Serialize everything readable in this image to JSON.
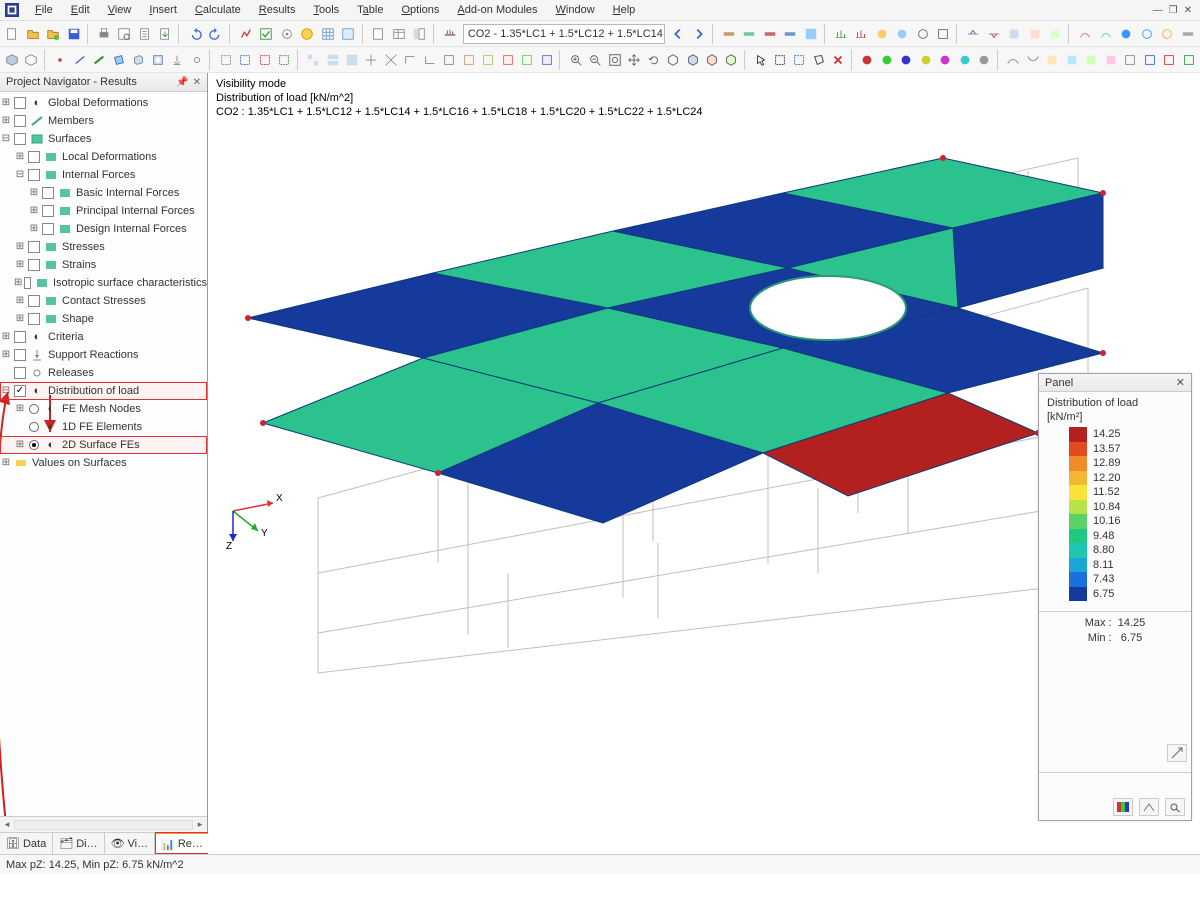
{
  "menu": {
    "items": [
      "File",
      "Edit",
      "View",
      "Insert",
      "Calculate",
      "Results",
      "Tools",
      "Table",
      "Options",
      "Add-on Modules",
      "Window",
      "Help"
    ]
  },
  "toolbar1": {
    "load_case": "CO2 - 1.35*LC1 + 1.5*LC12 + 1.5*LC14"
  },
  "sidebar": {
    "title": "Project Navigator - Results",
    "items": {
      "global_deformations": "Global Deformations",
      "members": "Members",
      "surfaces": "Surfaces",
      "local_deformations": "Local Deformations",
      "internal_forces": "Internal Forces",
      "basic_internal_forces": "Basic Internal Forces",
      "principal_internal_forces": "Principal Internal Forces",
      "design_internal_forces": "Design Internal Forces",
      "stresses": "Stresses",
      "strains": "Strains",
      "isotropic_surface": "Isotropic surface characteristics",
      "contact_stresses": "Contact Stresses",
      "shape": "Shape",
      "criteria": "Criteria",
      "support_reactions": "Support Reactions",
      "releases": "Releases",
      "distribution_of_load": "Distribution of load",
      "fe_mesh_nodes": "FE Mesh Nodes",
      "one_d_fe_elements": "1D FE Elements",
      "two_d_surface_fes": "2D Surface FEs",
      "values_on_surfaces": "Values on Surfaces"
    },
    "tabs": {
      "data": "Data",
      "display": "Di…",
      "views": "Vi…",
      "results": "Re…"
    }
  },
  "viewport": {
    "line1": "Visibility mode",
    "line2": "Distribution of load [kN/m^2]",
    "line3": "CO2 : 1.35*LC1 + 1.5*LC12 + 1.5*LC14 + 1.5*LC16 + 1.5*LC18 + 1.5*LC20 + 1.5*LC22 + 1.5*LC24",
    "axes": {
      "x": "X",
      "y": "Y",
      "z": "Z"
    }
  },
  "panel": {
    "title": "Panel",
    "heading": "Distribution of load",
    "unit": "[kN/m²]",
    "ticks": [
      "14.25",
      "13.57",
      "12.89",
      "12.20",
      "11.52",
      "10.84",
      "10.16",
      "9.48",
      "8.80",
      "8.11",
      "7.43",
      "6.75"
    ],
    "colors": [
      "#b32020",
      "#e24a1f",
      "#f08a2a",
      "#f4b733",
      "#f8e23b",
      "#b7e24b",
      "#5ad169",
      "#23c784",
      "#20c7b0",
      "#1aa7d6",
      "#1d6fe0",
      "#153a9c"
    ],
    "max_label": "Max :",
    "max_value": "14.25",
    "min_label": "Min :",
    "min_value": "6.75"
  },
  "status": {
    "text": "Max pZ: 14.25, Min pZ: 6.75 kN/m^2"
  },
  "chart_data": {
    "type": "heatmap",
    "title": "Distribution of load",
    "unit": "kN/m^2",
    "legend_range": [
      6.75,
      14.25
    ],
    "legend_ticks": [
      14.25,
      13.57,
      12.89,
      12.2,
      11.52,
      10.84,
      10.16,
      9.48,
      8.8,
      8.11,
      7.43,
      6.75
    ],
    "load_combination": "CO2 : 1.35*LC1 + 1.5*LC12 + 1.5*LC14 + 1.5*LC16 + 1.5*LC18 + 1.5*LC20 + 1.5*LC22 + 1.5*LC24",
    "note": "3D isometric plan view of a floor slab subdivided into a checker pattern of roughly 4×4 rectangular surface FE patches with a circular opening near the upper-right; most patches read ≈6.75–8.8 (dark blue) alternating with ≈9.5–10.8 (green/teal); one lower-right patch reads ≈14.25 (red)."
  }
}
